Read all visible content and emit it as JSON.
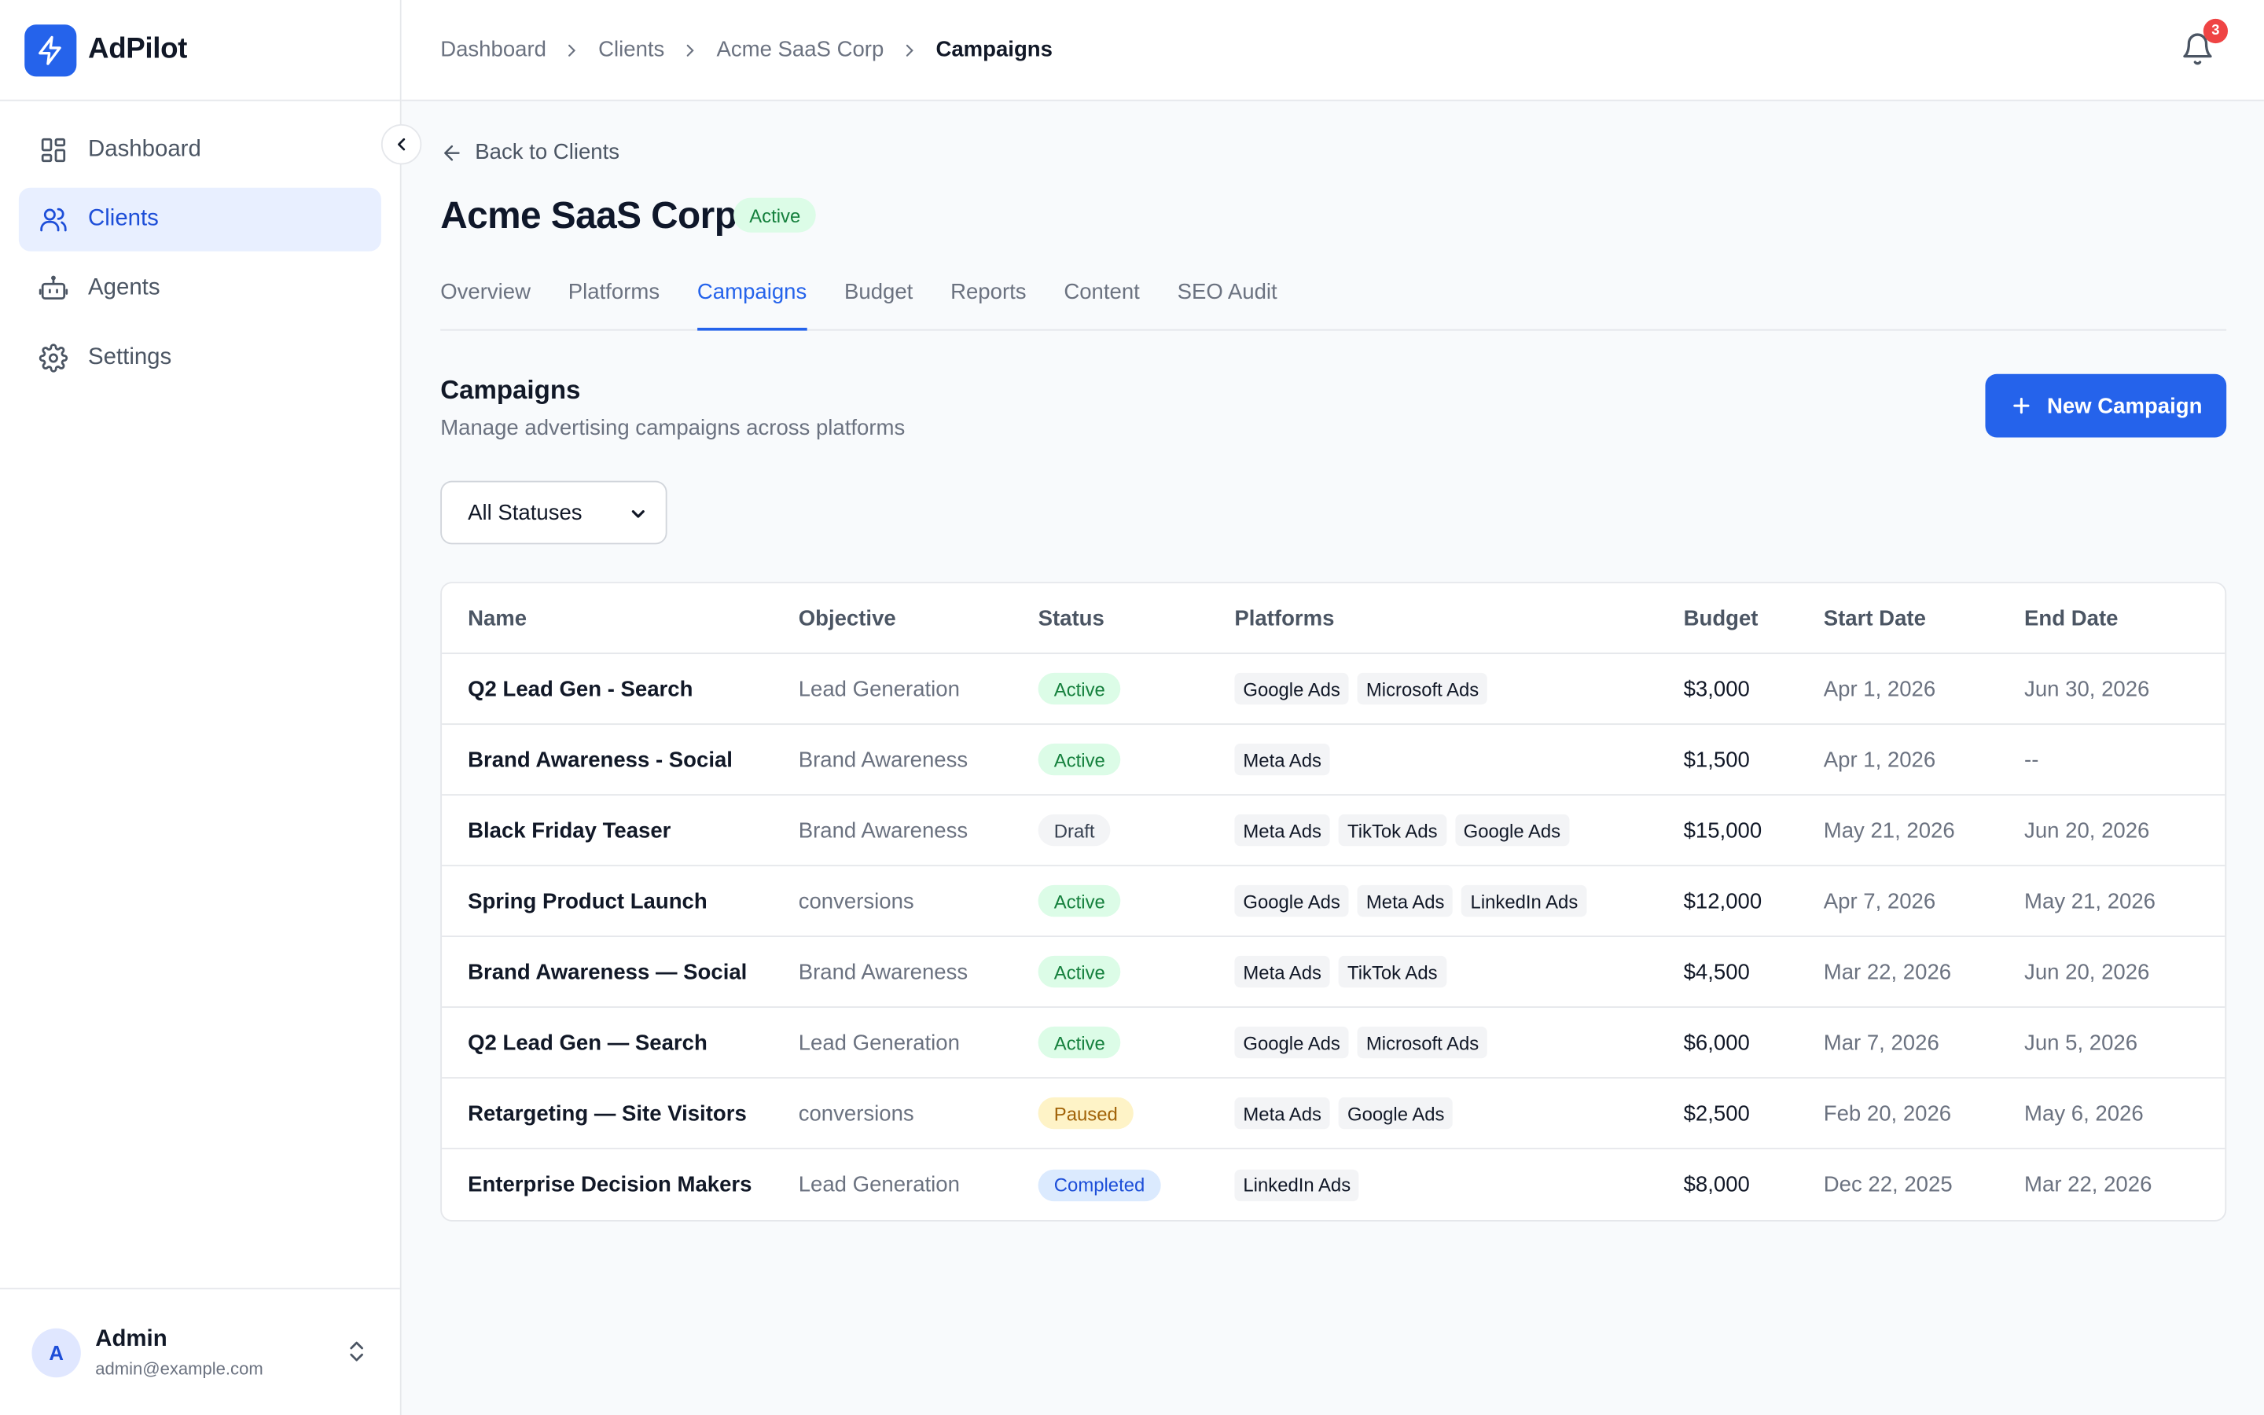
{
  "app": {
    "name": "AdPilot"
  },
  "sidebar": {
    "items": [
      {
        "label": "Dashboard",
        "icon": "dashboard-icon",
        "active": false
      },
      {
        "label": "Clients",
        "icon": "users-icon",
        "active": true
      },
      {
        "label": "Agents",
        "icon": "bot-icon",
        "active": false
      },
      {
        "label": "Settings",
        "icon": "gear-icon",
        "active": false
      }
    ],
    "user": {
      "initial": "A",
      "name": "Admin",
      "email": "admin@example.com"
    }
  },
  "header": {
    "breadcrumbs": [
      "Dashboard",
      "Clients",
      "Acme SaaS Corp",
      "Campaigns"
    ],
    "notifications_count": "3"
  },
  "client": {
    "back_label": "Back to Clients",
    "name": "Acme SaaS Corp",
    "status": "Active"
  },
  "tabs": [
    "Overview",
    "Platforms",
    "Campaigns",
    "Budget",
    "Reports",
    "Content",
    "SEO Audit"
  ],
  "active_tab": "Campaigns",
  "campaigns": {
    "title": "Campaigns",
    "subtitle": "Manage advertising campaigns across platforms",
    "new_button": "New Campaign",
    "filter": {
      "selected": "All Statuses"
    },
    "columns": [
      "Name",
      "Objective",
      "Status",
      "Platforms",
      "Budget",
      "Start Date",
      "End Date"
    ],
    "rows": [
      {
        "name": "Q2 Lead Gen - Search",
        "objective": "Lead Generation",
        "status": "Active",
        "platforms": [
          "Google Ads",
          "Microsoft Ads"
        ],
        "budget": "$3,000",
        "start": "Apr 1, 2026",
        "end": "Jun 30, 2026"
      },
      {
        "name": "Brand Awareness - Social",
        "objective": "Brand Awareness",
        "status": "Active",
        "platforms": [
          "Meta Ads"
        ],
        "budget": "$1,500",
        "start": "Apr 1, 2026",
        "end": "--"
      },
      {
        "name": "Black Friday Teaser",
        "objective": "Brand Awareness",
        "status": "Draft",
        "platforms": [
          "Meta Ads",
          "TikTok Ads",
          "Google Ads"
        ],
        "budget": "$15,000",
        "start": "May 21, 2026",
        "end": "Jun 20, 2026"
      },
      {
        "name": "Spring Product Launch",
        "objective": "conversions",
        "status": "Active",
        "platforms": [
          "Google Ads",
          "Meta Ads",
          "LinkedIn Ads"
        ],
        "budget": "$12,000",
        "start": "Apr 7, 2026",
        "end": "May 21, 2026"
      },
      {
        "name": "Brand Awareness — Social",
        "objective": "Brand Awareness",
        "status": "Active",
        "platforms": [
          "Meta Ads",
          "TikTok Ads"
        ],
        "budget": "$4,500",
        "start": "Mar 22, 2026",
        "end": "Jun 20, 2026"
      },
      {
        "name": "Q2 Lead Gen — Search",
        "objective": "Lead Generation",
        "status": "Active",
        "platforms": [
          "Google Ads",
          "Microsoft Ads"
        ],
        "budget": "$6,000",
        "start": "Mar 7, 2026",
        "end": "Jun 5, 2026"
      },
      {
        "name": "Retargeting — Site Visitors",
        "objective": "conversions",
        "status": "Paused",
        "platforms": [
          "Meta Ads",
          "Google Ads"
        ],
        "budget": "$2,500",
        "start": "Feb 20, 2026",
        "end": "May 6, 2026"
      },
      {
        "name": "Enterprise Decision Makers",
        "objective": "Lead Generation",
        "status": "Completed",
        "platforms": [
          "LinkedIn Ads"
        ],
        "budget": "$8,000",
        "start": "Dec 22, 2025",
        "end": "Mar 22, 2026"
      }
    ]
  },
  "colors": {
    "accent": "#2563eb",
    "active_bg": "#dcfce7",
    "active_text": "#15803d",
    "paused_bg": "#fef3c7",
    "completed_bg": "#dbeafe",
    "badge": "#ef4444"
  }
}
